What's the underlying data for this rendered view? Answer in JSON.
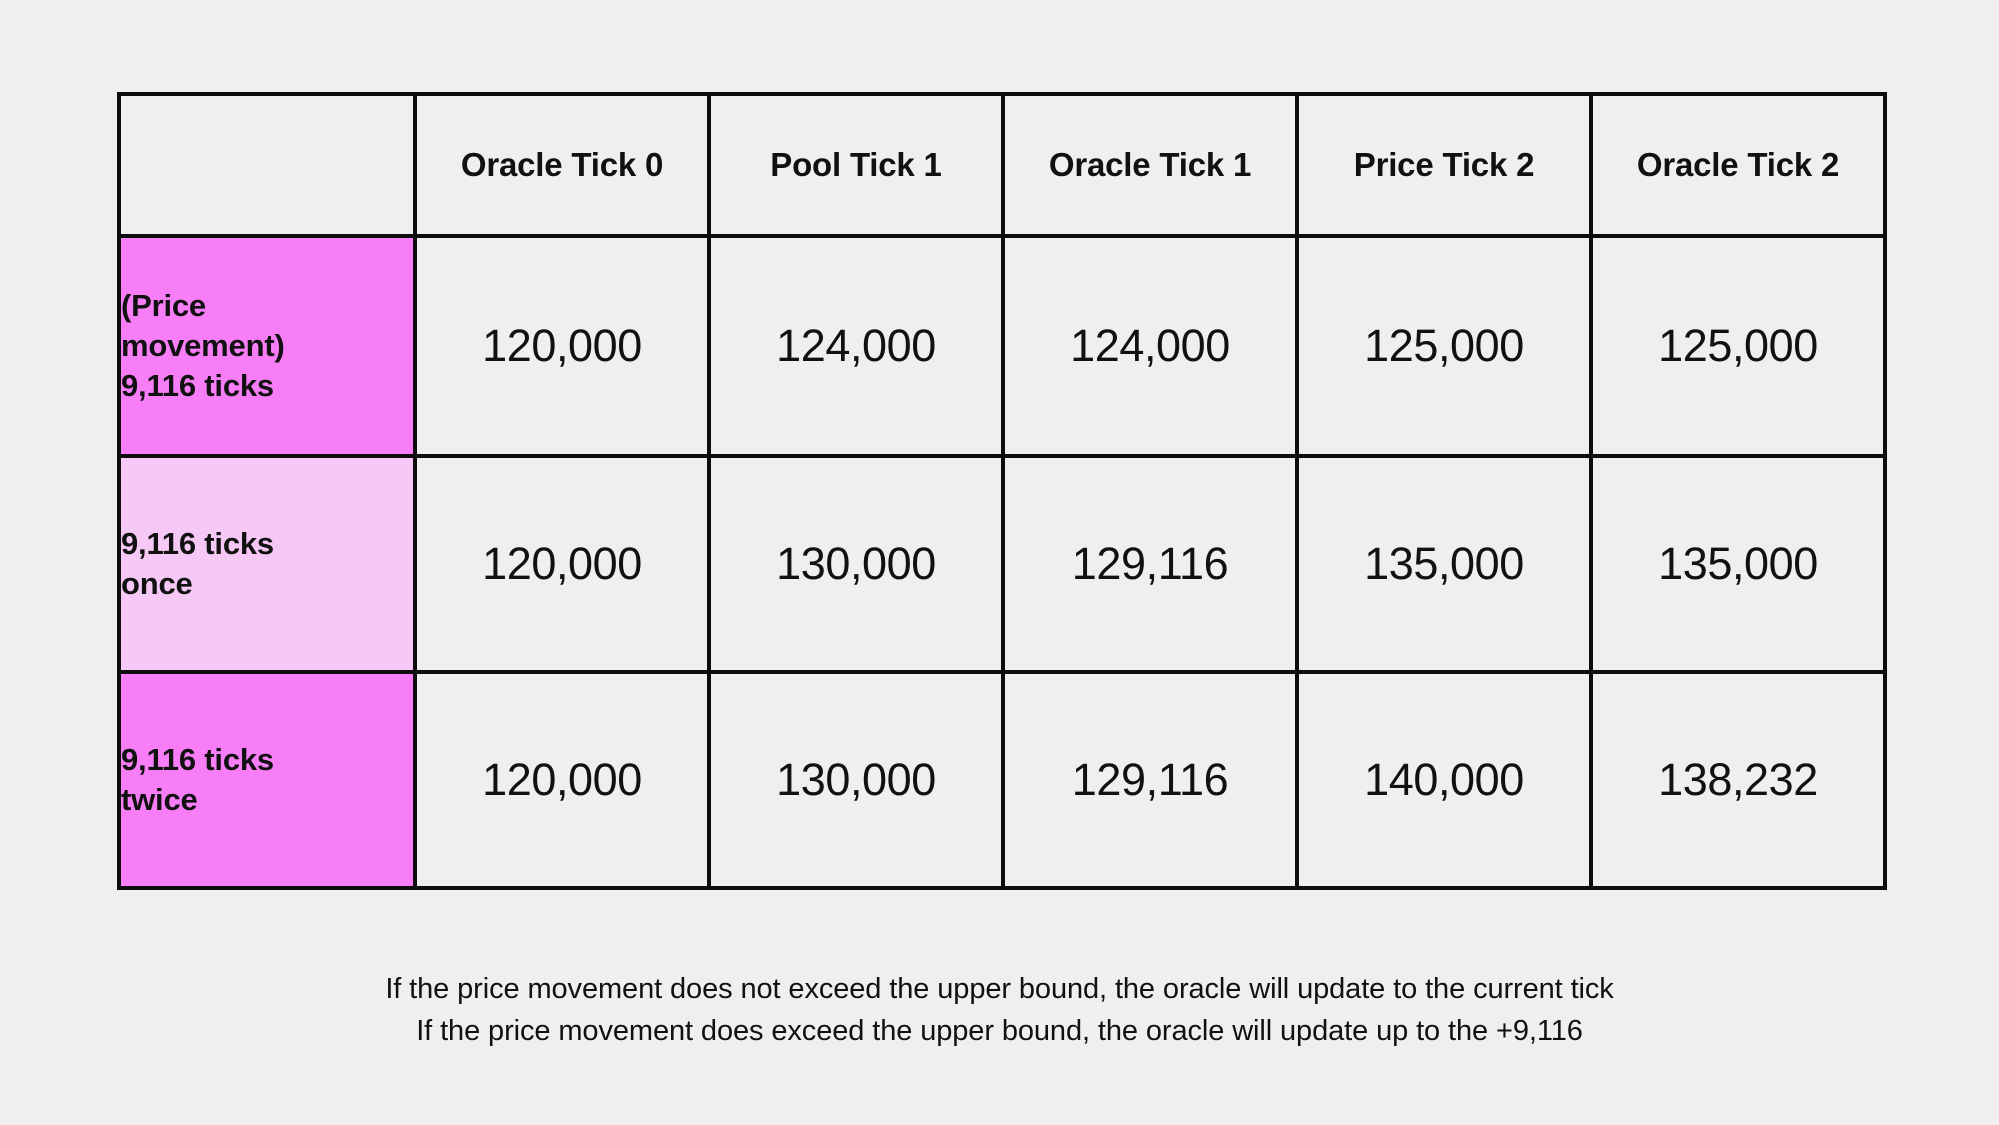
{
  "table": {
    "corner_label": "",
    "columns": [
      "Oracle Tick 0",
      "Pool Tick 1",
      "Oracle Tick 1",
      "Price Tick 2",
      "Oracle Tick 2"
    ],
    "rows": [
      {
        "label": "(Price\nmovement)\n9,116 ticks",
        "values": [
          "120,000",
          "124,000",
          "124,000",
          "125,000",
          "125,000"
        ]
      },
      {
        "label": "9,116 ticks\nonce",
        "values": [
          "120,000",
          "130,000",
          "129,116",
          "135,000",
          "135,000"
        ]
      },
      {
        "label": "9,116 ticks\ntwice",
        "values": [
          "120,000",
          "130,000",
          "129,116",
          "140,000",
          "138,232"
        ]
      }
    ]
  },
  "caption": {
    "line1": "If the price movement does not exceed the upper bound, the oracle will update to the current tick",
    "line2": "If the price movement does exceed the upper bound, the oracle will update up to the +9,116"
  },
  "colors": {
    "page_background": "#efefef",
    "header_cell": "#aab4f8",
    "row_label_strong": "#f87ef8",
    "row_label_soft": "#f5c8f5",
    "cell_background": "#efefef",
    "border": "#0d0d0d",
    "text": "#111111"
  },
  "chart_data": {
    "type": "table",
    "title": "",
    "categories": [
      "Oracle Tick 0",
      "Pool Tick 1",
      "Oracle Tick 1",
      "Price Tick 2",
      "Oracle Tick 2"
    ],
    "series": [
      {
        "name": "(Price movement) 9,116 ticks",
        "values": [
          120000,
          124000,
          124000,
          125000,
          125000
        ]
      },
      {
        "name": "9,116 ticks once",
        "values": [
          120000,
          130000,
          129116,
          135000,
          135000
        ]
      },
      {
        "name": "9,116 ticks twice",
        "values": [
          120000,
          130000,
          129116,
          140000,
          138232
        ]
      }
    ],
    "xlabel": "",
    "ylabel": "",
    "annotations": [
      "If the price movement does not exceed the upper bound, the oracle will update to the current tick",
      "If the price movement does exceed the upper bound, the oracle will update up to the +9,116"
    ]
  }
}
